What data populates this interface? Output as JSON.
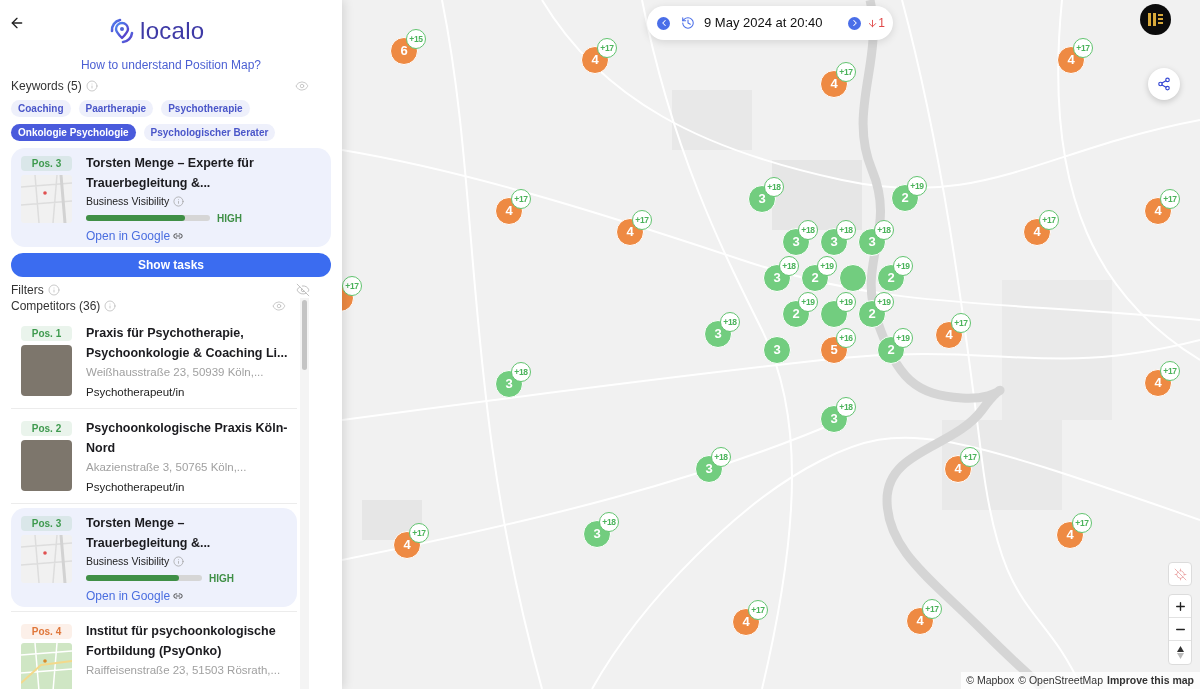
{
  "panel": {
    "logo": "localo",
    "help_link": "How to understand Position Map?",
    "keywords": {
      "label": "Keywords (5)",
      "visible": true,
      "tags": [
        {
          "label": "Coaching",
          "selected": false
        },
        {
          "label": "Paartherapie",
          "selected": false
        },
        {
          "label": "Psychotherapie",
          "selected": false
        },
        {
          "label": "Onkologie Psychologie",
          "selected": true
        },
        {
          "label": "Psychologischer Berater",
          "selected": false
        }
      ]
    },
    "business": {
      "position": "Pos. 3",
      "color": "#3f9a4f",
      "thumbnail": {
        "kind": "map"
      },
      "title": "Torsten Menge – Experte für Trauerbegleitung &...",
      "visibility_label": "Business Visibility",
      "level": 0.8,
      "rating": "HIGH",
      "link": "Open in Google"
    },
    "show_tasks": "Show tasks",
    "filters": {
      "label": "Filters",
      "visible": false
    },
    "competitors": {
      "label": "Competitors (36)",
      "visible": true,
      "items": [
        {
          "kind": "listing",
          "selected": false,
          "position": "Pos. 1",
          "color": "#3f9a4f",
          "thumbnail": {
            "kind": "photo"
          },
          "title": "Praxis für Psychotherapie, Psychoonkologie & Coaching Li...",
          "address": "Weißhausstraße 23, 50939 Köln,...",
          "category": "Psychotherapeut/in"
        },
        {
          "kind": "listing",
          "selected": false,
          "position": "Pos. 2",
          "color": "#3f9a4f",
          "thumbnail": {
            "kind": "photo"
          },
          "title": "Psychoonkologische Praxis Köln-Nord",
          "address": "Akazienstraße 3, 50765 Köln,...",
          "category": "Psychotherapeut/in"
        },
        {
          "kind": "visibility",
          "selected": true,
          "position": "Pos. 3",
          "color": "#3f9a4f",
          "thumbnail": {
            "kind": "map"
          },
          "title": "Torsten Menge – Trauerbegleitung &...",
          "visibility_label": "Business Visibility",
          "level": 0.8,
          "rating": "HIGH",
          "link": "Open in Google"
        },
        {
          "kind": "listing",
          "selected": false,
          "position": "Pos. 4",
          "color": "#e0773a",
          "thumbnail": {
            "kind": "color-map"
          },
          "title": "Institut für psychoonkologische Fortbildung (PsyOnko)",
          "address": "Raiffeisenstraße 23, 51503 Rösrath,..."
        }
      ]
    }
  },
  "map": {
    "date": "9 May 2024 at 20:40",
    "change": "1",
    "locate": {
      "disabled": true
    },
    "markers": [
      {
        "count": "6",
        "badge": "+15",
        "color": "#ee8a43"
      },
      {
        "count": "4",
        "badge": "+17",
        "color": "#ee8a43"
      },
      {
        "count": "4",
        "badge": "+17",
        "color": "#ee8a43"
      },
      {
        "count": "4",
        "badge": "+17",
        "color": "#ee8a43"
      },
      {
        "count": "3",
        "badge": "+18",
        "color": "#72cd7f"
      },
      {
        "count": "2",
        "badge": "+19",
        "color": "#72cd7f"
      },
      {
        "count": "4",
        "badge": "+17",
        "color": "#ee8a43"
      },
      {
        "count": "4",
        "badge": "+17",
        "color": "#ee8a43"
      },
      {
        "count": "4",
        "badge": "+17",
        "color": "#ee8a43"
      },
      {
        "count": "4",
        "badge": "+17",
        "color": "#ee8a43"
      },
      {
        "count": "3",
        "badge": "+18",
        "color": "#72cd7f"
      },
      {
        "count": "3",
        "badge": "+18",
        "color": "#72cd7f"
      },
      {
        "count": "3",
        "badge": "+18",
        "color": "#72cd7f"
      },
      {
        "count": "3",
        "badge": "+18",
        "color": "#72cd7f"
      },
      {
        "count": "2",
        "badge": "+19",
        "color": "#72cd7f"
      },
      {
        "color": "#72cd7f"
      },
      {
        "count": "2",
        "badge": "+19",
        "color": "#72cd7f"
      },
      {
        "badge": "+17",
        "color": "#ee8a43"
      },
      {
        "count": "2",
        "badge": "+19",
        "color": "#72cd7f"
      },
      {
        "badge": "+19",
        "color": "#72cd7f"
      },
      {
        "count": "2",
        "badge": "+19",
        "color": "#72cd7f"
      },
      {
        "count": "3",
        "badge": "+18",
        "color": "#72cd7f"
      },
      {
        "count": "4",
        "badge": "+17",
        "color": "#ee8a43"
      },
      {
        "count": "3",
        "color": "#72cd7f"
      },
      {
        "count": "5",
        "badge": "+16",
        "color": "#ee8a43"
      },
      {
        "count": "2",
        "badge": "+19",
        "color": "#72cd7f"
      },
      {
        "count": "3",
        "badge": "+18",
        "color": "#72cd7f"
      },
      {
        "count": "4",
        "badge": "+17",
        "color": "#ee8a43"
      },
      {
        "count": "3",
        "badge": "+18",
        "color": "#72cd7f"
      },
      {
        "count": "3",
        "badge": "+18",
        "color": "#72cd7f"
      },
      {
        "count": "4",
        "badge": "+17",
        "color": "#ee8a43"
      },
      {
        "count": "3",
        "badge": "+18",
        "color": "#72cd7f"
      },
      {
        "count": "4",
        "badge": "+17",
        "color": "#ee8a43"
      },
      {
        "count": "4",
        "badge": "+17",
        "color": "#ee8a43"
      },
      {
        "count": "4",
        "badge": "+17",
        "color": "#ee8a43"
      },
      {
        "count": "4",
        "badge": "+17",
        "color": "#ee8a43"
      }
    ],
    "attribution": [
      "© Mapbox",
      "© OpenStreetMap"
    ],
    "improve_link": "Improve this map"
  }
}
